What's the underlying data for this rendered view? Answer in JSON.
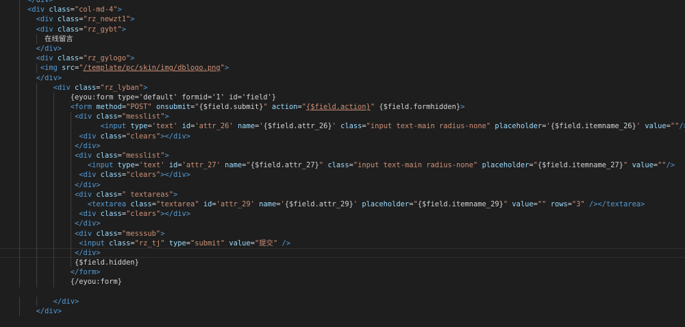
{
  "editor": {
    "theme_colors": {
      "background": "#1e1e1e",
      "tag": "#569cd6",
      "attribute": "#9cdcfe",
      "string": "#ce9178",
      "text": "#d4d4d4"
    },
    "current_line": 26,
    "lines": [
      {
        "indent": 4,
        "segs": [
          [
            "tag",
            "</div>"
          ]
        ]
      },
      {
        "indent": 4,
        "segs": [
          [
            "tag",
            "<div"
          ],
          [
            "txt",
            " "
          ],
          [
            "attr",
            "class"
          ],
          [
            "txt",
            "="
          ],
          [
            "str",
            "\"col-md-4\""
          ],
          [
            "tag",
            ">"
          ]
        ]
      },
      {
        "indent": 6,
        "segs": [
          [
            "tag",
            "<div"
          ],
          [
            "txt",
            " "
          ],
          [
            "attr",
            "class"
          ],
          [
            "txt",
            "="
          ],
          [
            "str",
            "\"rz_newzt1\""
          ],
          [
            "tag",
            ">"
          ]
        ]
      },
      {
        "indent": 6,
        "segs": [
          [
            "tag",
            "<div"
          ],
          [
            "txt",
            " "
          ],
          [
            "attr",
            "class"
          ],
          [
            "txt",
            "="
          ],
          [
            "str",
            "\"rz_gybt\""
          ],
          [
            "tag",
            ">"
          ]
        ]
      },
      {
        "indent": 8,
        "segs": [
          [
            "cjk",
            "在线留言"
          ]
        ]
      },
      {
        "indent": 6,
        "segs": [
          [
            "tag",
            "</div>"
          ]
        ]
      },
      {
        "indent": 6,
        "segs": [
          [
            "tag",
            "<div"
          ],
          [
            "txt",
            " "
          ],
          [
            "attr",
            "class"
          ],
          [
            "txt",
            "="
          ],
          [
            "str",
            "\"rz_gylogo\""
          ],
          [
            "tag",
            ">"
          ]
        ]
      },
      {
        "indent": 7,
        "segs": [
          [
            "tag",
            "<img"
          ],
          [
            "txt",
            " "
          ],
          [
            "attr",
            "src"
          ],
          [
            "txt",
            "="
          ],
          [
            "str",
            "\""
          ],
          [
            "ul",
            "/template/pc/skin/img/dblogo.png"
          ],
          [
            "str",
            "\""
          ],
          [
            "tag",
            ">"
          ]
        ]
      },
      {
        "indent": 6,
        "segs": [
          [
            "tag",
            "</div>"
          ]
        ]
      },
      {
        "indent": 10,
        "segs": [
          [
            "tag",
            "<div"
          ],
          [
            "txt",
            " "
          ],
          [
            "attr",
            "class"
          ],
          [
            "txt",
            "="
          ],
          [
            "str",
            "\"rz_lyban\""
          ],
          [
            "tag",
            ">"
          ]
        ]
      },
      {
        "indent": 14,
        "segs": [
          [
            "txt",
            "{eyou:form type='default' formid='1' id='field'}"
          ]
        ]
      },
      {
        "indent": 14,
        "segs": [
          [
            "tag",
            "<form"
          ],
          [
            "txt",
            " "
          ],
          [
            "attr",
            "method"
          ],
          [
            "txt",
            "="
          ],
          [
            "str",
            "\"POST\""
          ],
          [
            "txt",
            " "
          ],
          [
            "attr",
            "onsubmit"
          ],
          [
            "txt",
            "="
          ],
          [
            "str",
            "\""
          ],
          [
            "txt",
            "{$field.submit}"
          ],
          [
            "str",
            "\""
          ],
          [
            "txt",
            " "
          ],
          [
            "attr",
            "action"
          ],
          [
            "txt",
            "="
          ],
          [
            "str",
            "\""
          ],
          [
            "ul",
            "{$field.action}"
          ],
          [
            "str",
            "\""
          ],
          [
            "txt",
            " {$field.formhidden}"
          ],
          [
            "tag",
            ">"
          ]
        ]
      },
      {
        "indent": 15,
        "segs": [
          [
            "tag",
            "<div"
          ],
          [
            "txt",
            " "
          ],
          [
            "attr",
            "class"
          ],
          [
            "txt",
            "="
          ],
          [
            "str",
            "\"messlist\""
          ],
          [
            "tag",
            ">"
          ]
        ]
      },
      {
        "indent": 21,
        "segs": [
          [
            "tag",
            "<input"
          ],
          [
            "txt",
            " "
          ],
          [
            "attr",
            "type"
          ],
          [
            "txt",
            "="
          ],
          [
            "str",
            "'text'"
          ],
          [
            "txt",
            " "
          ],
          [
            "attr",
            "id"
          ],
          [
            "txt",
            "="
          ],
          [
            "str",
            "'attr_26'"
          ],
          [
            "txt",
            " "
          ],
          [
            "attr",
            "name"
          ],
          [
            "txt",
            "="
          ],
          [
            "str",
            "'"
          ],
          [
            "txt",
            "{$field.attr_26}"
          ],
          [
            "str",
            "'"
          ],
          [
            "txt",
            " "
          ],
          [
            "attr",
            "class"
          ],
          [
            "txt",
            "="
          ],
          [
            "str",
            "\"input text-main radius-none\""
          ],
          [
            "txt",
            " "
          ],
          [
            "attr",
            "placeholder"
          ],
          [
            "txt",
            "="
          ],
          [
            "str",
            "'"
          ],
          [
            "txt",
            "{$field.itemname_26}"
          ],
          [
            "str",
            "'"
          ],
          [
            "txt",
            " "
          ],
          [
            "attr",
            "value"
          ],
          [
            "txt",
            "="
          ],
          [
            "str",
            "\"\""
          ],
          [
            "tag",
            "/>"
          ]
        ]
      },
      {
        "indent": 16,
        "segs": [
          [
            "tag",
            "<div"
          ],
          [
            "txt",
            " "
          ],
          [
            "attr",
            "class"
          ],
          [
            "txt",
            "="
          ],
          [
            "str",
            "\"clears\""
          ],
          [
            "tag",
            "></div>"
          ]
        ]
      },
      {
        "indent": 15,
        "segs": [
          [
            "tag",
            "</div>"
          ]
        ]
      },
      {
        "indent": 15,
        "segs": [
          [
            "tag",
            "<div"
          ],
          [
            "txt",
            " "
          ],
          [
            "attr",
            "class"
          ],
          [
            "txt",
            "="
          ],
          [
            "str",
            "\"messlist\""
          ],
          [
            "tag",
            ">"
          ]
        ]
      },
      {
        "indent": 18,
        "segs": [
          [
            "tag",
            "<input"
          ],
          [
            "txt",
            " "
          ],
          [
            "attr",
            "type"
          ],
          [
            "txt",
            "="
          ],
          [
            "str",
            "'text'"
          ],
          [
            "txt",
            " "
          ],
          [
            "attr",
            "id"
          ],
          [
            "txt",
            "="
          ],
          [
            "str",
            "'attr_27'"
          ],
          [
            "txt",
            " "
          ],
          [
            "attr",
            "name"
          ],
          [
            "txt",
            "="
          ],
          [
            "str",
            "\""
          ],
          [
            "txt",
            "{$field.attr_27}"
          ],
          [
            "str",
            "\""
          ],
          [
            "txt",
            " "
          ],
          [
            "attr",
            "class"
          ],
          [
            "txt",
            "="
          ],
          [
            "str",
            "\"input text-main radius-none\""
          ],
          [
            "txt",
            " "
          ],
          [
            "attr",
            "placeholder"
          ],
          [
            "txt",
            "="
          ],
          [
            "str",
            "\""
          ],
          [
            "txt",
            "{$field.itemname_27}"
          ],
          [
            "str",
            "\""
          ],
          [
            "txt",
            " "
          ],
          [
            "attr",
            "value"
          ],
          [
            "txt",
            "="
          ],
          [
            "str",
            "\"\""
          ],
          [
            "tag",
            "/>"
          ]
        ]
      },
      {
        "indent": 16,
        "segs": [
          [
            "tag",
            "<div"
          ],
          [
            "txt",
            " "
          ],
          [
            "attr",
            "class"
          ],
          [
            "txt",
            "="
          ],
          [
            "str",
            "\"clears\""
          ],
          [
            "tag",
            "></div>"
          ]
        ]
      },
      {
        "indent": 15,
        "segs": [
          [
            "tag",
            "</div>"
          ]
        ]
      },
      {
        "indent": 15,
        "segs": [
          [
            "tag",
            "<div"
          ],
          [
            "txt",
            " "
          ],
          [
            "attr",
            "class"
          ],
          [
            "txt",
            "="
          ],
          [
            "str",
            "\" textareas\""
          ],
          [
            "tag",
            ">"
          ]
        ]
      },
      {
        "indent": 18,
        "segs": [
          [
            "tag",
            "<textarea"
          ],
          [
            "txt",
            " "
          ],
          [
            "attr",
            "class"
          ],
          [
            "txt",
            "="
          ],
          [
            "str",
            "\"textarea\""
          ],
          [
            "txt",
            " "
          ],
          [
            "attr",
            "id"
          ],
          [
            "txt",
            "="
          ],
          [
            "str",
            "'attr_29'"
          ],
          [
            "txt",
            " "
          ],
          [
            "attr",
            "name"
          ],
          [
            "txt",
            "="
          ],
          [
            "str",
            "'"
          ],
          [
            "txt",
            "{$field.attr_29}"
          ],
          [
            "str",
            "'"
          ],
          [
            "txt",
            " "
          ],
          [
            "attr",
            "placeholder"
          ],
          [
            "txt",
            "="
          ],
          [
            "str",
            "\""
          ],
          [
            "txt",
            "{$field.itemname_29}"
          ],
          [
            "str",
            "\""
          ],
          [
            "txt",
            " "
          ],
          [
            "attr",
            "value"
          ],
          [
            "txt",
            "="
          ],
          [
            "str",
            "\"\""
          ],
          [
            "txt",
            " "
          ],
          [
            "attr",
            "rows"
          ],
          [
            "txt",
            "="
          ],
          [
            "str",
            "\"3\""
          ],
          [
            "txt",
            " "
          ],
          [
            "tag",
            "/></textarea>"
          ]
        ]
      },
      {
        "indent": 16,
        "segs": [
          [
            "tag",
            "<div"
          ],
          [
            "txt",
            " "
          ],
          [
            "attr",
            "class"
          ],
          [
            "txt",
            "="
          ],
          [
            "str",
            "\"clears\""
          ],
          [
            "tag",
            "></div>"
          ]
        ]
      },
      {
        "indent": 15,
        "segs": [
          [
            "tag",
            "</div>"
          ]
        ]
      },
      {
        "indent": 15,
        "segs": [
          [
            "tag",
            "<div"
          ],
          [
            "txt",
            " "
          ],
          [
            "attr",
            "class"
          ],
          [
            "txt",
            "="
          ],
          [
            "str",
            "\"messsub\""
          ],
          [
            "tag",
            ">"
          ]
        ]
      },
      {
        "indent": 16,
        "segs": [
          [
            "tag",
            "<input"
          ],
          [
            "txt",
            " "
          ],
          [
            "attr",
            "class"
          ],
          [
            "txt",
            "="
          ],
          [
            "str",
            "\"rz_tj\""
          ],
          [
            "txt",
            " "
          ],
          [
            "attr",
            "type"
          ],
          [
            "txt",
            "="
          ],
          [
            "str",
            "\"submit\""
          ],
          [
            "txt",
            " "
          ],
          [
            "attr",
            "value"
          ],
          [
            "txt",
            "="
          ],
          [
            "str",
            "\""
          ],
          [
            "strcjk",
            "提交"
          ],
          [
            "str",
            "\""
          ],
          [
            "txt",
            " "
          ],
          [
            "tag",
            "/>"
          ]
        ]
      },
      {
        "indent": 15,
        "segs": [
          [
            "tag",
            "</div>"
          ]
        ]
      },
      {
        "indent": 15,
        "segs": [
          [
            "txt",
            "{$field.hidden}"
          ]
        ]
      },
      {
        "indent": 14,
        "segs": [
          [
            "tag",
            "</form>"
          ]
        ]
      },
      {
        "indent": 14,
        "segs": [
          [
            "txt",
            "{/eyou:form}"
          ]
        ]
      },
      {
        "indent": 0,
        "segs": []
      },
      {
        "indent": 10,
        "segs": [
          [
            "tag",
            "</div>"
          ]
        ]
      },
      {
        "indent": 6,
        "segs": [
          [
            "tag",
            "</div>"
          ]
        ]
      },
      {
        "indent": 0,
        "segs": []
      }
    ]
  }
}
